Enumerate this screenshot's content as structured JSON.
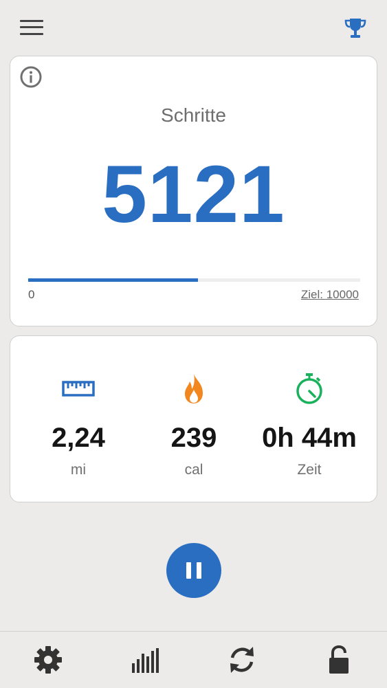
{
  "steps_card": {
    "title": "Schritte",
    "count": "5121",
    "progress_min": "0",
    "goal_label": "Ziel: 10000",
    "progress_fraction": 0.512
  },
  "stats": [
    {
      "icon": "ruler-icon",
      "value": "2,24",
      "unit": "mi",
      "color": "#2a6ec1"
    },
    {
      "icon": "flame-icon",
      "value": "239",
      "unit": "cal",
      "color": "#f2871f"
    },
    {
      "icon": "stopwatch-icon",
      "value": "0h 44m",
      "unit": "Zeit",
      "color": "#19b15b"
    }
  ],
  "colors": {
    "accent": "#2a6ec1",
    "background": "#ecebe9"
  },
  "bottom_nav": [
    "gear-icon",
    "bar-chart-icon",
    "refresh-icon",
    "lock-icon"
  ]
}
